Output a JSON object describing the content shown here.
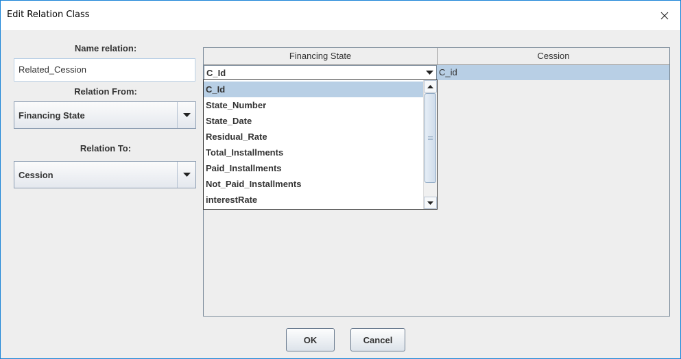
{
  "window": {
    "title": "Edit Relation Class",
    "close_glyph": "✕"
  },
  "form": {
    "name_label": "Name relation:",
    "name_value": "Related_Cession",
    "from_label": "Relation From:",
    "from_value": "Financing State",
    "to_label": "Relation To:",
    "to_value": "Cession"
  },
  "table": {
    "headers": [
      "Financing State",
      "Cession"
    ],
    "row": {
      "left_value": "C_Id",
      "right_value": "C_id"
    }
  },
  "dropdown": {
    "items": [
      "C_Id",
      "State_Number",
      "State_Date",
      "Residual_Rate",
      "Total_Installments",
      "Paid_Installments",
      "Not_Paid_Installments",
      "interestRate"
    ],
    "selected": "C_Id"
  },
  "buttons": {
    "ok": "OK",
    "cancel": "Cancel"
  },
  "colors": {
    "selection": "#b8cfe5",
    "window_border": "#1883d7",
    "background": "#eeeeee"
  },
  "icons": {
    "close": "close-icon",
    "combo_arrow": "caret-down-icon",
    "scroll_up": "caret-up-icon",
    "scroll_down": "caret-down-icon"
  }
}
